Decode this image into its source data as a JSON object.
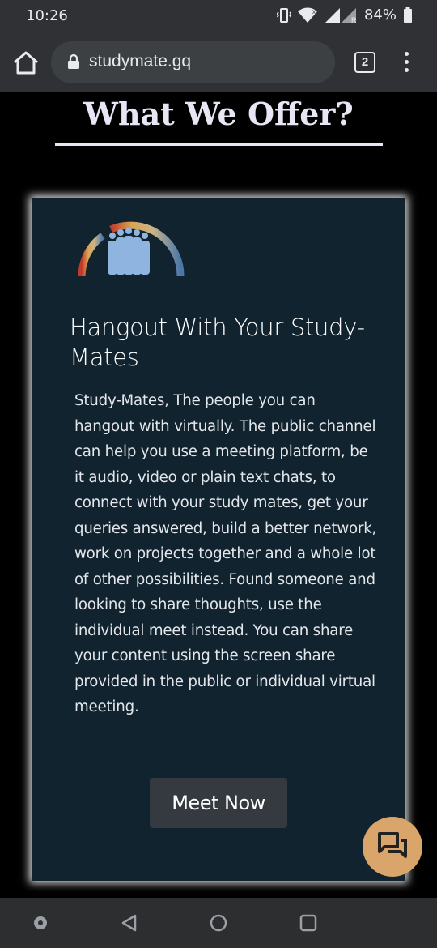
{
  "status_bar": {
    "time": "10:26",
    "battery": "84%"
  },
  "browser": {
    "url": "studymate.gq",
    "tab_count": "2"
  },
  "page": {
    "section_title": "What We Offer?",
    "card": {
      "title": "Hangout With Your Study-Mates",
      "body": "Study-Mates, The people you can hangout with virtually. The public channel can help you use a meeting platform, be it audio, video or plain text chats, to connect with your study mates, get your queries answered, build a better network, work on projects together and a whole lot of other possibilities. Found someone and looking to share thoughts, use the individual meet instead. You can share your content using the screen share provided in the public or individual virtual meeting.",
      "button_label": "Meet Now"
    }
  },
  "colors": {
    "card_background": "#11232f",
    "chat_fab": "#d9a56a",
    "title": "#e6e6f5"
  },
  "icons": [
    "vibrate-icon",
    "wifi-icon",
    "signal-icon",
    "battery-icon",
    "home-icon",
    "lock-icon",
    "tabs-icon",
    "more-vert-icon",
    "study-group-logo",
    "chat-icon",
    "back-icon",
    "home-circle-icon",
    "recents-icon"
  ]
}
